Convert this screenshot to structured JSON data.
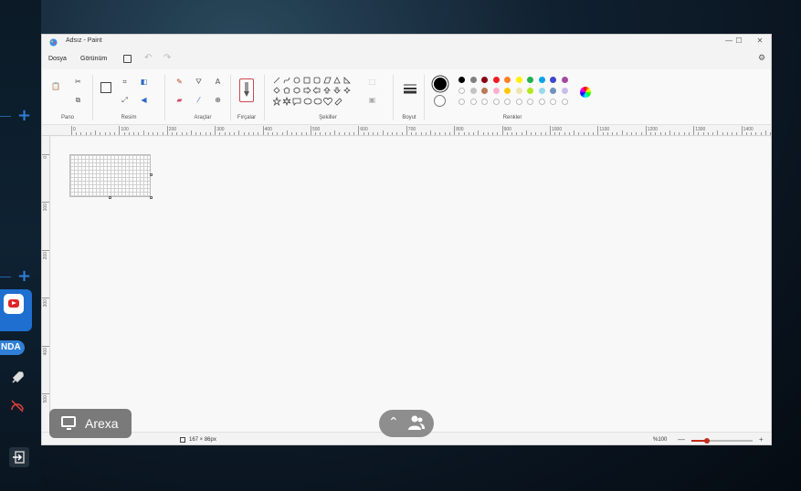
{
  "window": {
    "title": "Adsız - Paint",
    "controls": {
      "minimize": "—",
      "maximize": "☐",
      "close": "✕"
    }
  },
  "menu": {
    "file": "Dosya",
    "view": "Görünüm"
  },
  "ribbon": {
    "groups": {
      "clipboard": "Pano",
      "image": "Resim",
      "tools": "Araçlar",
      "brushes": "Fırçalar",
      "shapes": "Şekiller",
      "size": "Boyut",
      "colors": "Renkler"
    },
    "palette_row1": [
      "#000000",
      "#7f7f7f",
      "#880015",
      "#ed1c24",
      "#ff7f27",
      "#fff200",
      "#22b14c",
      "#00a2e8",
      "#3f48cc",
      "#a349a4"
    ],
    "palette_row2": [
      "#ffffff",
      "#c3c3c3",
      "#b97a57",
      "#ffaec9",
      "#ffc90e",
      "#efe4b0",
      "#b5e61d",
      "#99d9ea",
      "#7092be",
      "#c8bfe7"
    ],
    "primary_color": "#000000",
    "secondary_color": "#ffffff"
  },
  "ruler": {
    "top_labels": [
      "0",
      "100",
      "200",
      "300",
      "400",
      "500",
      "600",
      "700",
      "800",
      "900",
      "1000",
      "1100",
      "1200",
      "1300",
      "1400"
    ],
    "left_labels": [
      "0",
      "100",
      "200",
      "300",
      "400",
      "500"
    ]
  },
  "status": {
    "canvas_size": "167 × 86px",
    "zoom": "%100",
    "zoom_minus": "—",
    "zoom_plus": "+"
  },
  "taskbar": {
    "arexa_label": "Arexa",
    "nda_badge": "NDA"
  }
}
